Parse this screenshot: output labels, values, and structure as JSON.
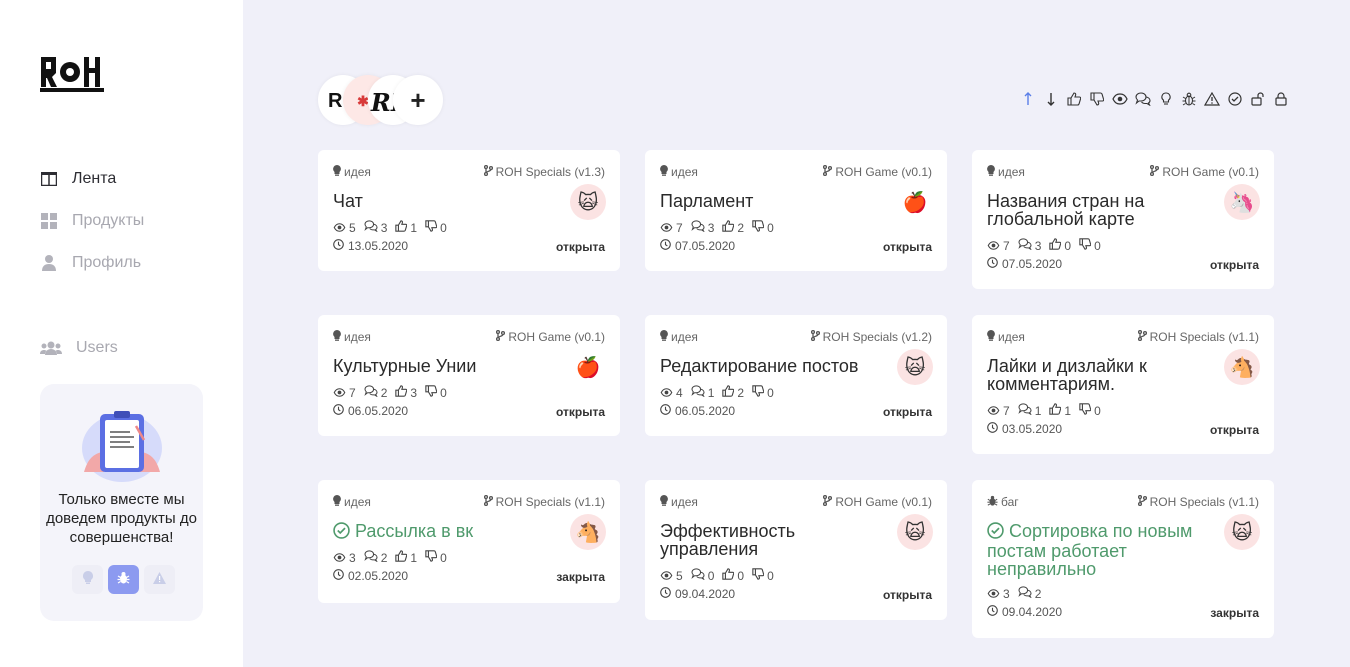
{
  "sidebar": {
    "logo_text": "ROH",
    "nav": [
      {
        "label": "Лента",
        "icon": "feed-icon",
        "active": true
      },
      {
        "label": "Продукты",
        "icon": "grid-icon",
        "active": false
      },
      {
        "label": "Профиль",
        "icon": "user-icon",
        "active": false
      }
    ],
    "users_label": "Users",
    "promo": {
      "text": "Только вместе мы доведем продукты до совершенства!",
      "buttons": [
        "idea-icon",
        "bug-icon",
        "warning-icon"
      ]
    }
  },
  "topbar": {
    "avatars": [
      "ROH",
      "ROH Specials",
      "ROH Game"
    ],
    "add_label": "+",
    "filters": [
      "sort-up-icon",
      "sort-down-icon",
      "like-icon",
      "dislike-icon",
      "eye-icon",
      "comments-icon",
      "idea-icon",
      "bug-icon",
      "warning-icon",
      "check-circle-icon",
      "unlock-icon",
      "lock-icon"
    ]
  },
  "cards": [
    {
      "type": "идея",
      "product": "ROH Specials (v1.3)",
      "title": "Чат",
      "emoji": "🙀",
      "views": "5",
      "comments": "3",
      "likes": "1",
      "dislikes": "0",
      "date": "13.05.2020",
      "status": "открыта"
    },
    {
      "type": "идея",
      "product": "ROH Game (v0.1)",
      "title": "Парламент",
      "emoji": "🍎",
      "views": "7",
      "comments": "3",
      "likes": "2",
      "dislikes": "0",
      "date": "07.05.2020",
      "status": "открыта"
    },
    {
      "type": "идея",
      "product": "ROH Game (v0.1)",
      "title": "Названия стран на глобальной карте",
      "emoji": "🦄",
      "views": "7",
      "comments": "3",
      "likes": "0",
      "dislikes": "0",
      "date": "07.05.2020",
      "status": "открыта"
    },
    {
      "type": "идея",
      "product": "ROH Game (v0.1)",
      "title": "Культурные Унии",
      "emoji": "🍎",
      "views": "7",
      "comments": "2",
      "likes": "3",
      "dislikes": "0",
      "date": "06.05.2020",
      "status": "открыта"
    },
    {
      "type": "идея",
      "product": "ROH Specials (v1.2)",
      "title": "Редактирование постов",
      "emoji": "🙀",
      "views": "4",
      "comments": "1",
      "likes": "2",
      "dislikes": "0",
      "date": "06.05.2020",
      "status": "открыта"
    },
    {
      "type": "идея",
      "product": "ROH Specials (v1.1)",
      "title": "Лайки и дизлайки к комментариям.",
      "emoji": "🐴",
      "views": "7",
      "comments": "1",
      "likes": "1",
      "dislikes": "0",
      "date": "03.05.2020",
      "status": "открыта"
    },
    {
      "type": "идея",
      "product": "ROH Specials (v1.1)",
      "title": "Рассылка в вк",
      "emoji": "🐴",
      "views": "3",
      "comments": "2",
      "likes": "1",
      "dislikes": "0",
      "date": "02.05.2020",
      "status": "закрыта"
    },
    {
      "type": "идея",
      "product": "ROH Game (v0.1)",
      "title": "Эффективность управления",
      "emoji": "🙀",
      "views": "5",
      "comments": "0",
      "likes": "0",
      "dislikes": "0",
      "date": "09.04.2020",
      "status": "открыта"
    },
    {
      "type": "баг",
      "product": "ROH Specials (v1.1)",
      "title": "Сортировка по новым постам работает неправильно",
      "emoji": "🙀",
      "views": "3",
      "comments": "2",
      "date": "09.04.2020",
      "status": "закрыта"
    }
  ]
}
